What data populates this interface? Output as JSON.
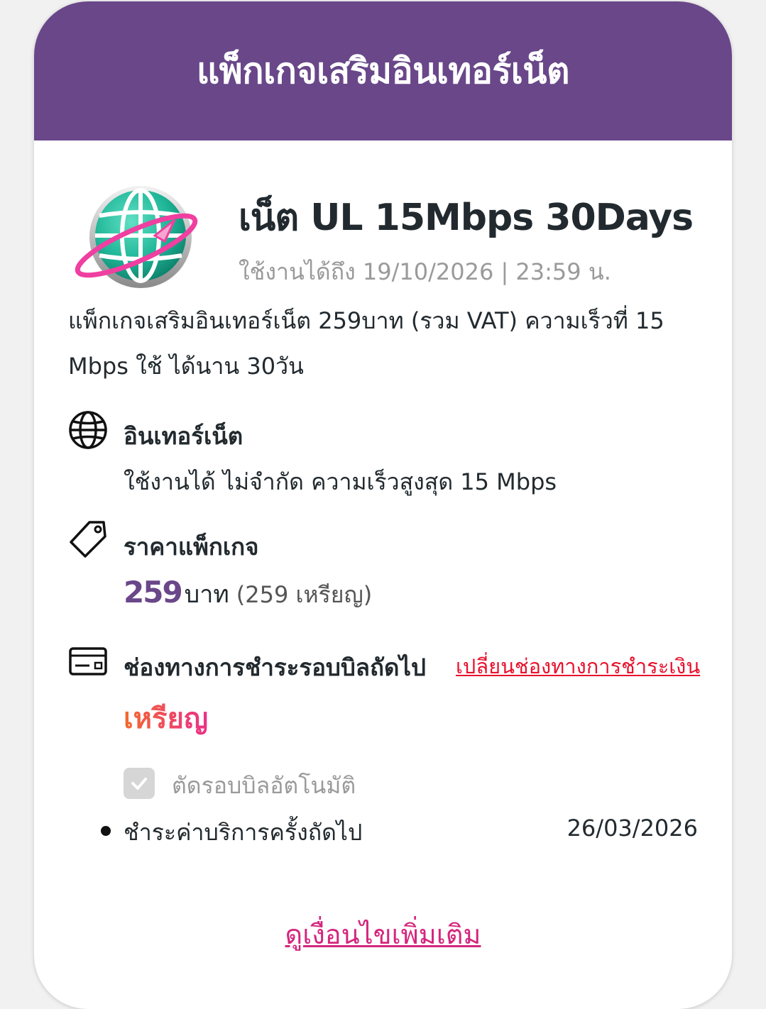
{
  "header": {
    "title": "แพ็กเกจเสริมอินเทอร์เน็ต"
  },
  "package": {
    "logo_icon": "internet-globe-icon",
    "name": "เน็ต UL 15Mbps 30Days",
    "validity": "ใช้งานได้ถึง 19/10/2026 | 23:59 น.",
    "description": "แพ็กเกจเสริมอินเทอร์เน็ต 259บาท (รวม VAT) ความเร็วที่ 15 Mbps ใช้ ได้นาน 30วัน"
  },
  "internet": {
    "icon": "globe-icon",
    "title": "อินเทอร์เน็ต",
    "detail": "ใช้งานได้ ไม่จำกัด ความเร็วสูงสุด 15 Mbps"
  },
  "price": {
    "icon": "price-tag-icon",
    "title": "ราคาแพ็กเกจ",
    "amount": "259",
    "unit": "บาท",
    "coins": "(259 เหรียญ)"
  },
  "payment": {
    "icon": "credit-card-icon",
    "title": "ช่องทางการชำระรอบบิลถัดไป",
    "change_link": "เปลี่ยนช่องทางการชำระเงิน",
    "method": "เหรียญ",
    "auto_renew_label": "ตัดรอบบิลอัตโนมัติ",
    "auto_renew_checked": true,
    "next_payment_label": "ชำระค่าบริการครั้งถัดไป",
    "next_payment_date": "26/03/2026"
  },
  "footer": {
    "more_link": "ดูเงื่อนไขเพิ่มเติม"
  },
  "colors": {
    "header_bg": "#694789",
    "price_accent": "#694789",
    "link_red": "#e8112d",
    "link_pink": "#d4267d",
    "globe_teal": "#1fb597",
    "orbit_pink": "#ef3fa0"
  }
}
